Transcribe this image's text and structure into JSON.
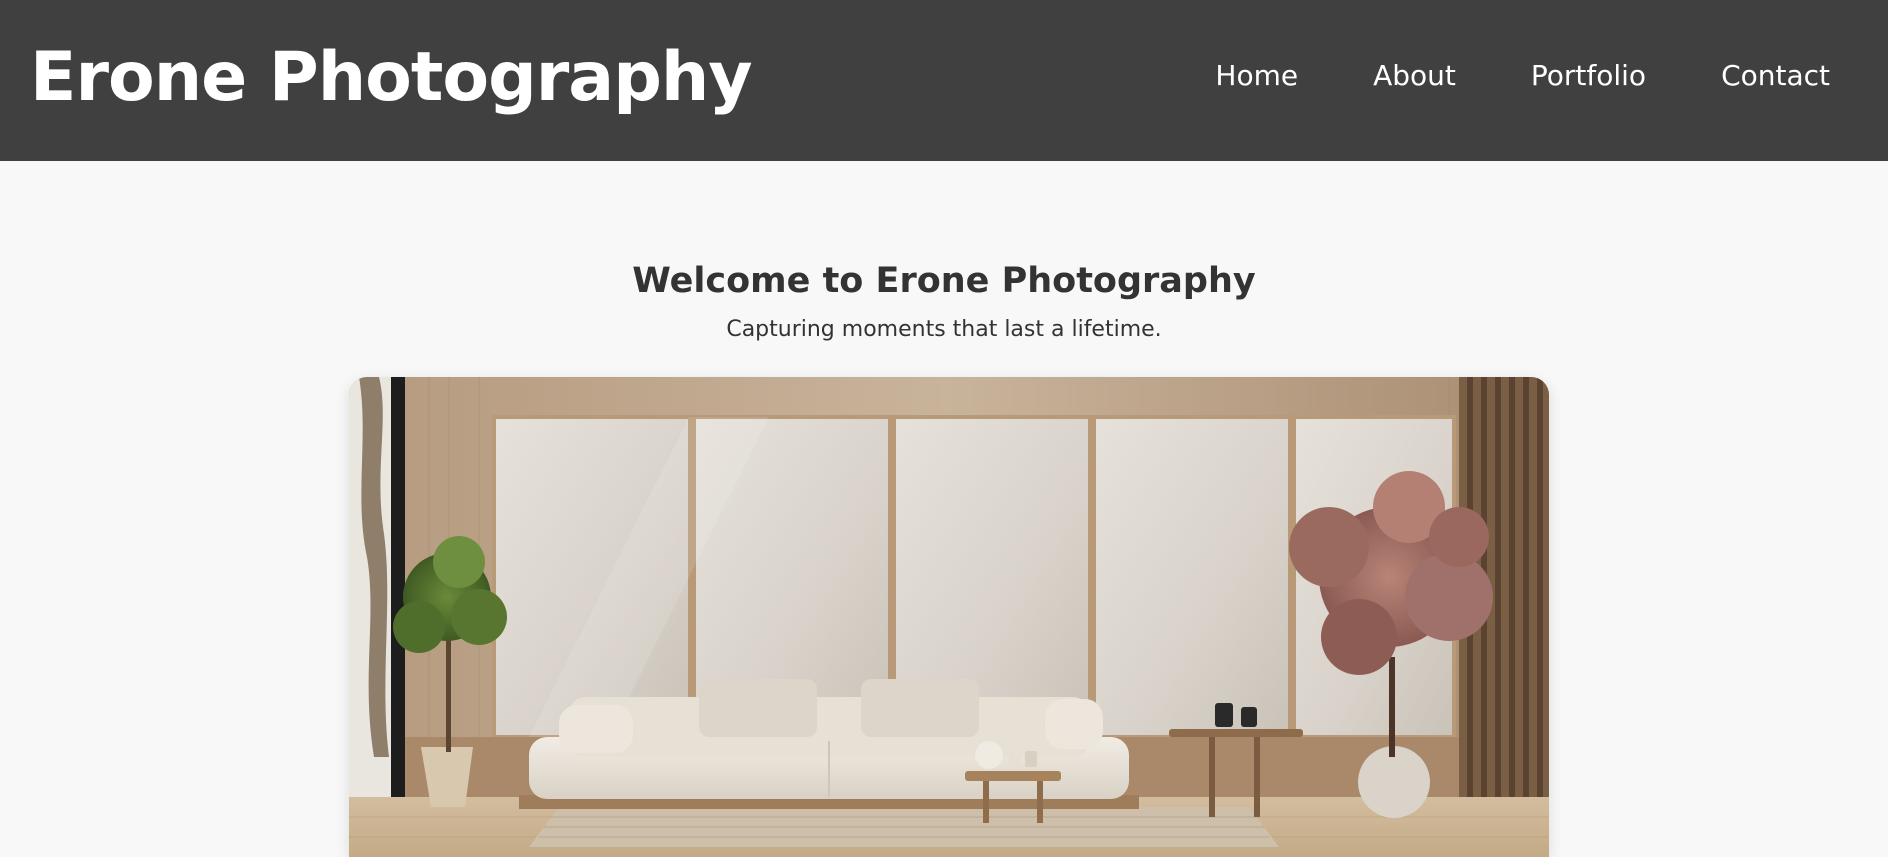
{
  "header": {
    "brand": "Erone Photography",
    "nav": [
      {
        "label": "Home"
      },
      {
        "label": "About"
      },
      {
        "label": "Portfolio"
      },
      {
        "label": "Contact"
      }
    ]
  },
  "hero": {
    "title": "Welcome to Erone Photography",
    "subtitle": "Capturing moments that last a lifetime."
  },
  "colors": {
    "header_bg": "#404040",
    "page_bg": "#f8f8f8",
    "text": "#333333",
    "header_text": "#ffffff"
  }
}
